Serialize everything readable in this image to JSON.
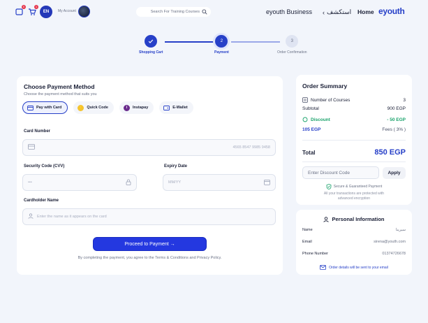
{
  "header": {
    "cart_count": "1",
    "wishlist_count": "0",
    "language": "EN",
    "account_label": "My Account",
    "search_placeholder": "Search For Training Courses",
    "business_label": "eyouth Business",
    "explore_label": "استكشف",
    "home_label": "Home",
    "logo_text": "eyouth"
  },
  "stepper": {
    "steps": [
      {
        "number": "1",
        "label": "Shopping Cart",
        "state": "done"
      },
      {
        "number": "2",
        "label": "Payment",
        "state": "active"
      },
      {
        "number": "3",
        "label": "Order Confirmation",
        "state": "pending"
      }
    ]
  },
  "payment": {
    "title": "Choose Payment Method",
    "subtitle": "Choose the payment method that suits you",
    "methods": [
      {
        "label": "Pay with Card",
        "icon": "card-icon",
        "selected": true
      },
      {
        "label": "Quick Code",
        "icon": "quick-code-icon",
        "selected": false
      },
      {
        "label": "Instapay",
        "icon": "instapay-icon",
        "selected": false
      },
      {
        "label": "E-Wallet",
        "icon": "wallet-icon",
        "selected": false
      }
    ],
    "card_number_label": "Card Number",
    "card_number_placeholder": "4565 8547 9985 9458",
    "cvv_label": "Security Code (CVV)",
    "cvv_placeholder": "•••",
    "expiry_label": "Expiry Date",
    "expiry_placeholder": "MM/YY",
    "holder_label": "Cardholder Name",
    "holder_placeholder": "Enter the name as it appears on the card",
    "proceed_label": "Proceed to Payment →",
    "terms_text": "By completing the payment, you agree to the Terms & Conditions and Privacy Policy."
  },
  "order_summary": {
    "title": "Order Summary",
    "courses_label": "Number of Courses",
    "courses_value": "3",
    "subtotal_label": "Subtotal",
    "subtotal_value": "900 EGP",
    "discount_label": "Discount",
    "discount_value": "- 50 EGP",
    "fees_amount": "105 EGP",
    "fees_label": "Fees ( 3% )",
    "total_label": "Total",
    "total_value": "850 EGP",
    "discount_code_placeholder": "Enter Discount Code",
    "apply_label": "Apply",
    "secure_label": "Secure & Guaranteed Payment",
    "secure_note": "All your transactions are protected with advanced encryption",
    "accent_color": "#2740c8",
    "discount_color": "#1aa36b"
  },
  "personal_info": {
    "title": "Personal Information",
    "name_label": "Name",
    "name_value": "سيرينا",
    "email_label": "Email",
    "email_value": "sirena@youth.com",
    "phone_label": "Phone Number",
    "phone_value": "01374726678",
    "note": "Order details will be sent to your email"
  }
}
